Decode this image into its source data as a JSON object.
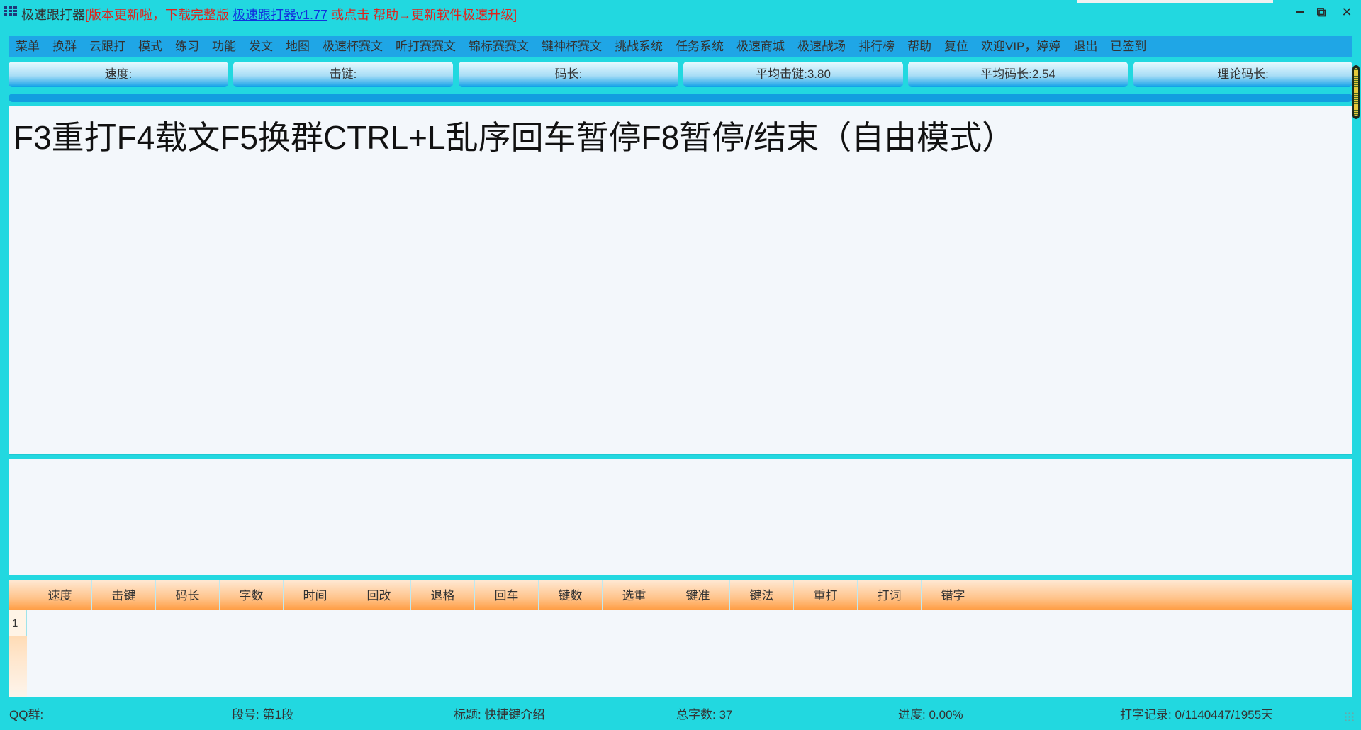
{
  "titlebar": {
    "app_name": "极速跟打器",
    "notice": "[版本更新啦，下载完整版 ",
    "link_text": "极速跟打器v1.77",
    "notice_tail": " 或点击 帮助→更新软件极速升级]",
    "minimize": "━",
    "restore": "⧉",
    "close": "✕"
  },
  "menu": [
    "菜单",
    "换群",
    "云跟打",
    "模式",
    "练习",
    "功能",
    "发文",
    "地图",
    "极速杯赛文",
    "听打赛赛文",
    "锦标赛赛文",
    "键神杯赛文",
    "挑战系统",
    "任务系统",
    "极速商城",
    "极速战场",
    "排行榜",
    "帮助",
    "复位",
    "欢迎VIP，婷婷",
    "退出",
    "已签到"
  ],
  "stats": [
    "速度:",
    "击键:",
    "码长:",
    "平均击键:3.80",
    "平均码长:2.54",
    "理论码长:"
  ],
  "article": {
    "text": "F3重打F4载文F5换群CTRL+L乱序回车暂停F8暂停/结束（自由模式）"
  },
  "table": {
    "headers": [
      "速度",
      "击键",
      "码长",
      "字数",
      "时间",
      "回改",
      "退格",
      "回车",
      "键数",
      "选重",
      "键准",
      "键法",
      "重打",
      "打词",
      "错字"
    ],
    "row_number": "1"
  },
  "status": {
    "qq_group": "QQ群:",
    "segment": "段号: 第1段",
    "title": "标题: 快捷键介绍",
    "total_chars": "总字数: 37",
    "progress": "进度: 0.00%",
    "record": "打字记录: 0/1140447/1955天"
  }
}
